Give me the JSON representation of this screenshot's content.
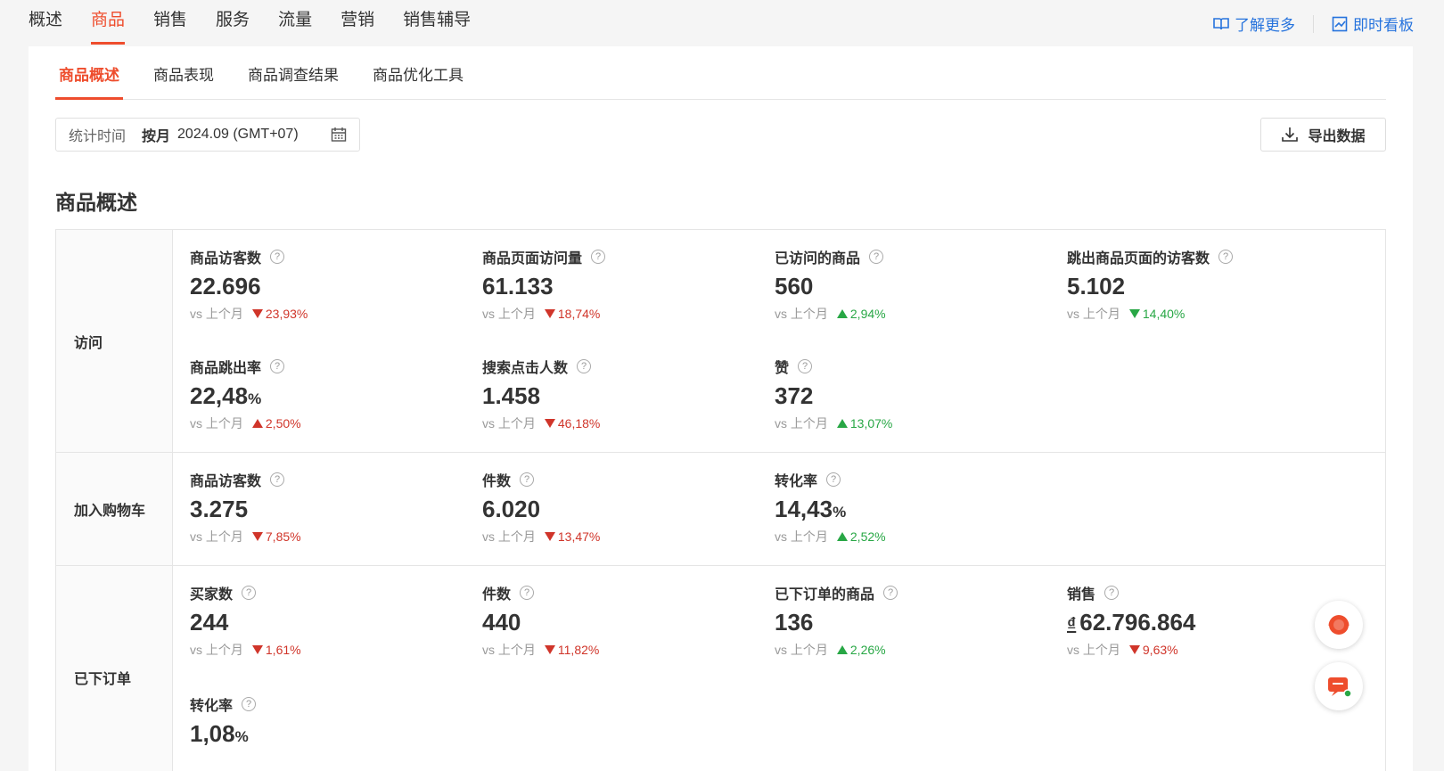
{
  "topnav": {
    "tabs": [
      "概述",
      "商品",
      "销售",
      "服务",
      "流量",
      "营销",
      "销售辅导"
    ],
    "active_index": 1,
    "learn_more": "了解更多",
    "dashboard": "即时看板"
  },
  "subtabs": [
    "商品概述",
    "商品表现",
    "商品调查结果",
    "商品优化工具"
  ],
  "date_filter": {
    "label": "统计时间",
    "mode": "按月",
    "value": "2024.09 (GMT+07)"
  },
  "export_label": "导出数据",
  "section_title": "商品概述",
  "compare_label": "vs 上个月",
  "groups": [
    {
      "label": "访问",
      "metrics": [
        {
          "name": "商品访客数",
          "value": "22.696",
          "change": "23,93%",
          "direction": "down",
          "color": "red"
        },
        {
          "name": "商品页面访问量",
          "value": "61.133",
          "change": "18,74%",
          "direction": "down",
          "color": "red"
        },
        {
          "name": "已访问的商品",
          "value": "560",
          "change": "2,94%",
          "direction": "up",
          "color": "green"
        },
        {
          "name": "跳出商品页面的访客数",
          "value": "5.102",
          "change": "14,40%",
          "direction": "down",
          "color": "green"
        },
        {
          "name": "商品跳出率",
          "value": "22,48",
          "unit": "%",
          "change": "2,50%",
          "direction": "up",
          "color": "red"
        },
        {
          "name": "搜索点击人数",
          "value": "1.458",
          "change": "46,18%",
          "direction": "down",
          "color": "red"
        },
        {
          "name": "赞",
          "value": "372",
          "change": "13,07%",
          "direction": "up",
          "color": "green"
        }
      ]
    },
    {
      "label": "加入购物车",
      "metrics": [
        {
          "name": "商品访客数",
          "value": "3.275",
          "change": "7,85%",
          "direction": "down",
          "color": "red"
        },
        {
          "name": "件数",
          "value": "6.020",
          "change": "13,47%",
          "direction": "down",
          "color": "red"
        },
        {
          "name": "转化率",
          "value": "14,43",
          "unit": "%",
          "change": "2,52%",
          "direction": "up",
          "color": "green"
        }
      ]
    },
    {
      "label": "已下订单",
      "metrics": [
        {
          "name": "买家数",
          "value": "244",
          "change": "1,61%",
          "direction": "down",
          "color": "red"
        },
        {
          "name": "件数",
          "value": "440",
          "change": "11,82%",
          "direction": "down",
          "color": "red"
        },
        {
          "name": "已下订单的商品",
          "value": "136",
          "change": "2,26%",
          "direction": "up",
          "color": "green"
        },
        {
          "name": "销售",
          "currency": "₫",
          "value": "62.796.864",
          "change": "9,63%",
          "direction": "down",
          "color": "red"
        },
        {
          "name": "转化率",
          "value": "1,08",
          "unit": "%"
        }
      ]
    }
  ],
  "colors": {
    "accent": "#ee4d2d",
    "link": "#2673dd",
    "down": "#d0352a",
    "up": "#28a745"
  }
}
